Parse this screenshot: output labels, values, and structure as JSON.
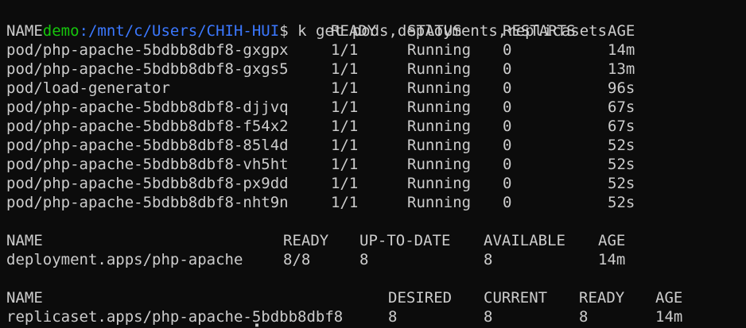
{
  "prompt": {
    "user": "demo",
    "path": ":/mnt/c/Users/CHIH-HUI",
    "sign": "$",
    "command": " k get pods,deployments,replicasets"
  },
  "pods": {
    "headers": [
      "NAME",
      "READY",
      "STATUS",
      "RESTARTS",
      "AGE"
    ],
    "rows": [
      [
        "pod/php-apache-5bdbb8dbf8-gxgpx",
        "1/1",
        "Running",
        "0",
        "14m"
      ],
      [
        "pod/php-apache-5bdbb8dbf8-gxgs5",
        "1/1",
        "Running",
        "0",
        "13m"
      ],
      [
        "pod/load-generator",
        "1/1",
        "Running",
        "0",
        "96s"
      ],
      [
        "pod/php-apache-5bdbb8dbf8-djjvq",
        "1/1",
        "Running",
        "0",
        "67s"
      ],
      [
        "pod/php-apache-5bdbb8dbf8-f54x2",
        "1/1",
        "Running",
        "0",
        "67s"
      ],
      [
        "pod/php-apache-5bdbb8dbf8-85l4d",
        "1/1",
        "Running",
        "0",
        "52s"
      ],
      [
        "pod/php-apache-5bdbb8dbf8-vh5ht",
        "1/1",
        "Running",
        "0",
        "52s"
      ],
      [
        "pod/php-apache-5bdbb8dbf8-px9dd",
        "1/1",
        "Running",
        "0",
        "52s"
      ],
      [
        "pod/php-apache-5bdbb8dbf8-nht9n",
        "1/1",
        "Running",
        "0",
        "52s"
      ]
    ]
  },
  "deployments": {
    "headers": [
      "NAME",
      "READY",
      "UP-TO-DATE",
      "AVAILABLE",
      "AGE"
    ],
    "rows": [
      [
        "deployment.apps/php-apache",
        "8/8",
        "8",
        "8",
        "14m"
      ]
    ]
  },
  "replicasets": {
    "headers": [
      "NAME",
      "DESIRED",
      "CURRENT",
      "READY",
      "AGE"
    ],
    "rows": [
      [
        "replicaset.apps/php-apache-5bdbb8dbf8",
        "8",
        "8",
        "8",
        "14m"
      ]
    ]
  },
  "colors": {
    "background": "#0c0c0c",
    "foreground": "#cccccc",
    "prompt_user": "#16c60c",
    "prompt_path": "#3b78ff"
  }
}
